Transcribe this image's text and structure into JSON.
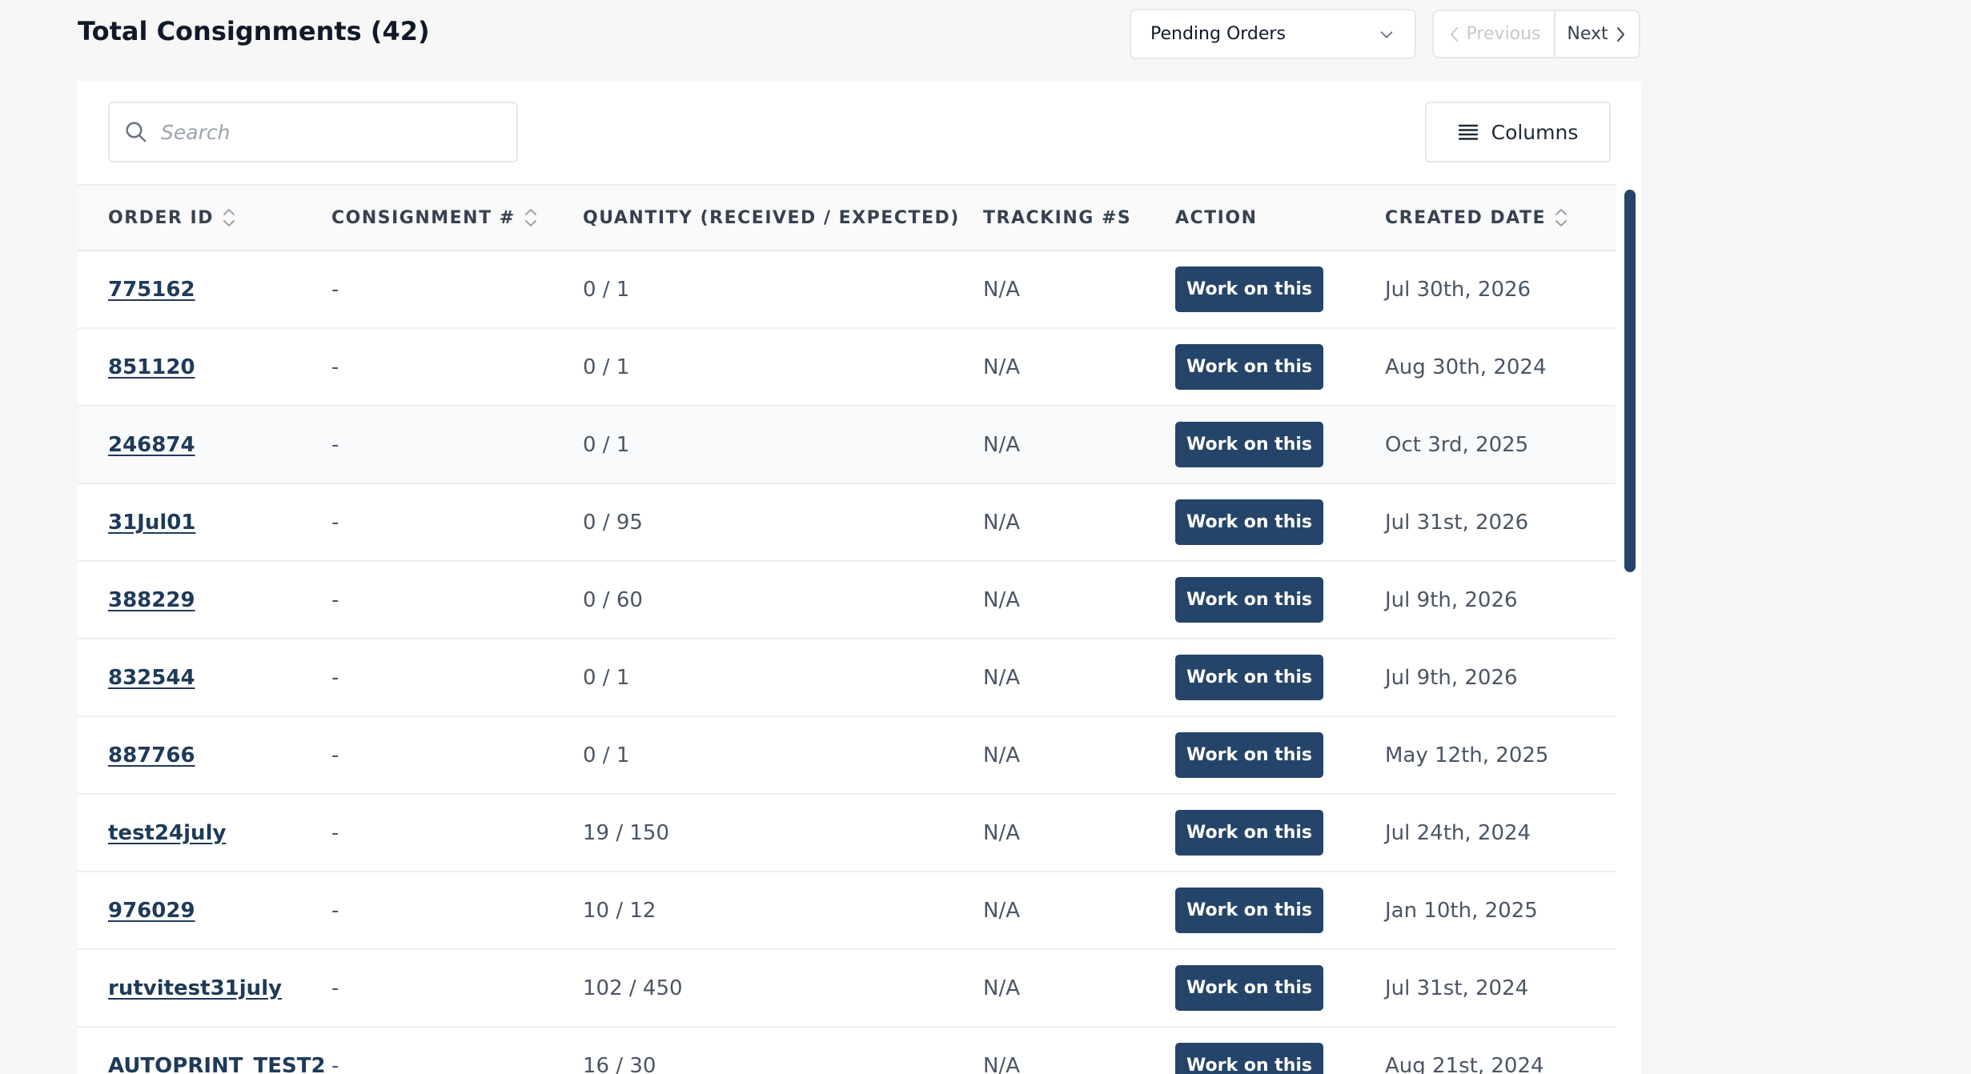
{
  "header": {
    "title": "Total Consignments (42)"
  },
  "filter": {
    "selected": "Pending Orders"
  },
  "pagination": {
    "previous_label": "Previous",
    "next_label": "Next"
  },
  "search": {
    "placeholder": "Search",
    "value": ""
  },
  "toolbar": {
    "columns_label": "Columns"
  },
  "table": {
    "columns": [
      "ORDER ID",
      "CONSIGNMENT #",
      "QUANTITY (RECEIVED / EXPECTED)",
      "TRACKING #S",
      "ACTION",
      "CREATED DATE"
    ],
    "action_label": "Work on this",
    "rows": [
      {
        "order_id": "775162",
        "consignment": "-",
        "quantity": "0 / 1",
        "tracking": "N/A",
        "created": "Jul 30th, 2026"
      },
      {
        "order_id": "851120",
        "consignment": "-",
        "quantity": "0 / 1",
        "tracking": "N/A",
        "created": "Aug 30th, 2024"
      },
      {
        "order_id": "246874",
        "consignment": "-",
        "quantity": "0 / 1",
        "tracking": "N/A",
        "created": "Oct 3rd, 2025"
      },
      {
        "order_id": "31Jul01",
        "consignment": "-",
        "quantity": "0 / 95",
        "tracking": "N/A",
        "created": "Jul 31st, 2026"
      },
      {
        "order_id": "388229",
        "consignment": "-",
        "quantity": "0 / 60",
        "tracking": "N/A",
        "created": "Jul 9th, 2026"
      },
      {
        "order_id": "832544",
        "consignment": "-",
        "quantity": "0 / 1",
        "tracking": "N/A",
        "created": "Jul 9th, 2026"
      },
      {
        "order_id": "887766",
        "consignment": "-",
        "quantity": "0 / 1",
        "tracking": "N/A",
        "created": "May 12th, 2025"
      },
      {
        "order_id": "test24july",
        "consignment": "-",
        "quantity": "19 / 150",
        "tracking": "N/A",
        "created": "Jul 24th, 2024"
      },
      {
        "order_id": "976029",
        "consignment": "-",
        "quantity": "10 / 12",
        "tracking": "N/A",
        "created": "Jan 10th, 2025"
      },
      {
        "order_id": "rutvitest31july",
        "consignment": "-",
        "quantity": "102 / 450",
        "tracking": "N/A",
        "created": "Jul 31st, 2024"
      },
      {
        "order_id": "AUTOPRINT_TEST2",
        "consignment": "-",
        "quantity": "16 / 30",
        "tracking": "N/A",
        "created": "Aug 21st, 2024"
      }
    ]
  }
}
